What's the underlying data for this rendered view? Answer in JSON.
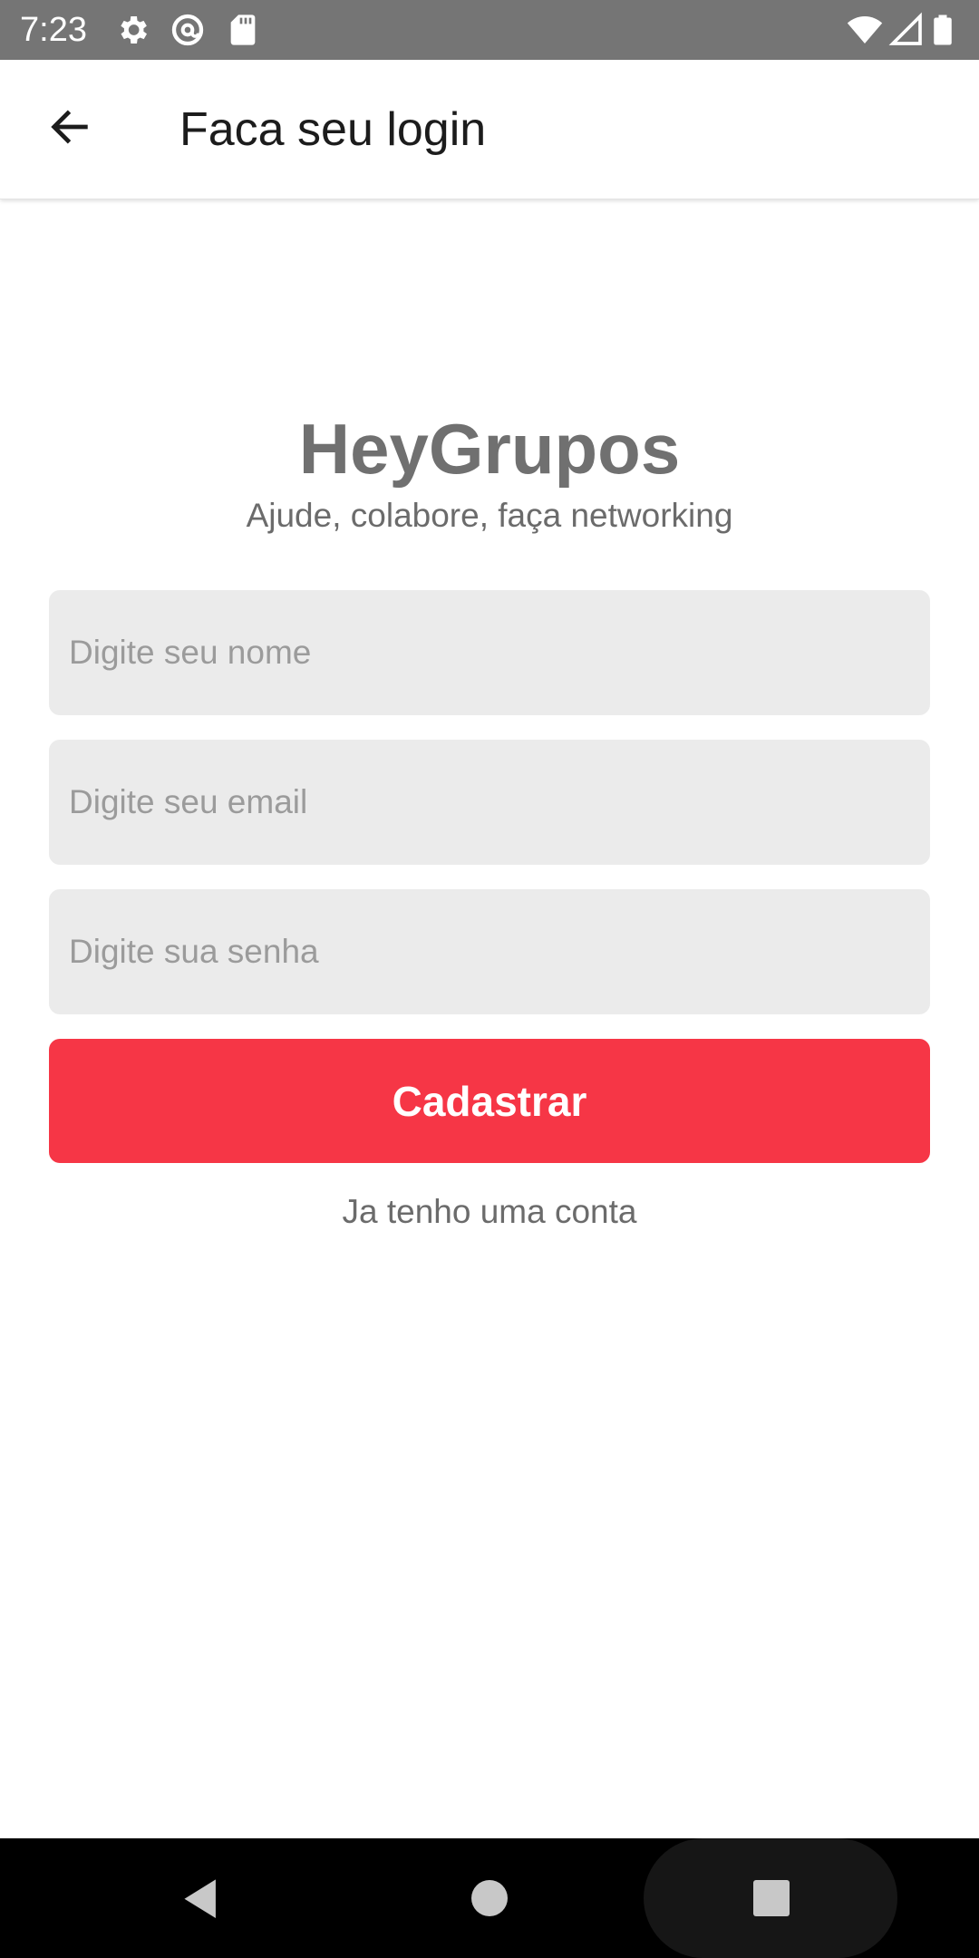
{
  "status_bar": {
    "time": "7:23",
    "left_icons": [
      "gear-icon",
      "at-sign-icon",
      "sd-card-icon"
    ],
    "right_icons": [
      "wifi-icon",
      "cell-signal-icon",
      "battery-icon"
    ],
    "background_color": "#757575"
  },
  "app_bar": {
    "title": "Faca seu login",
    "back_icon": "arrow-left-icon"
  },
  "brand": {
    "title": "HeyGrupos",
    "subtitle": "Ajude, colabore, faça networking"
  },
  "form": {
    "name_placeholder": "Digite seu nome",
    "email_placeholder": "Digite seu email",
    "password_placeholder": "Digite sua senha",
    "submit_label": "Cadastrar",
    "secondary_link": "Ja tenho uma conta"
  },
  "colors": {
    "accent": "#f63646",
    "input_background": "#ebebeb",
    "brand_text": "#707070"
  },
  "nav_bar": {
    "buttons": [
      "back-triangle-icon",
      "home-circle-icon",
      "recents-square-icon"
    ]
  }
}
